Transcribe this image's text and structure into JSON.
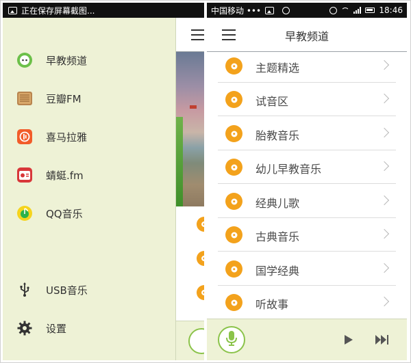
{
  "left_screen": {
    "status_text": "正在保存屏幕截图...",
    "drawer_items": [
      {
        "label": "早教频道",
        "icon": "smiley-face-icon"
      },
      {
        "label": "豆瓣FM",
        "icon": "radio-icon"
      },
      {
        "label": "喜马拉雅",
        "icon": "ximalaya-icon"
      },
      {
        "label": "蜻蜓.fm",
        "icon": "qingting-radio-icon"
      },
      {
        "label": "QQ音乐",
        "icon": "qq-music-icon"
      }
    ],
    "drawer_bottom_items": [
      {
        "label": "USB音乐",
        "icon": "usb-icon"
      },
      {
        "label": "设置",
        "icon": "gear-icon"
      }
    ]
  },
  "right_screen": {
    "status": {
      "carrier": "中国移动 •••",
      "time": "18:46"
    },
    "title": "早教频道",
    "list_items": [
      "主题精选",
      "试音区",
      "胎教音乐",
      "幼儿早教音乐",
      "经典儿歌",
      "古典音乐",
      "国学经典",
      "听故事"
    ]
  },
  "colors": {
    "drawer_bg": "#eef2d6",
    "disc_orange": "#f3a21c",
    "mic_green": "#8bc34a",
    "status_bar": "#111111"
  }
}
